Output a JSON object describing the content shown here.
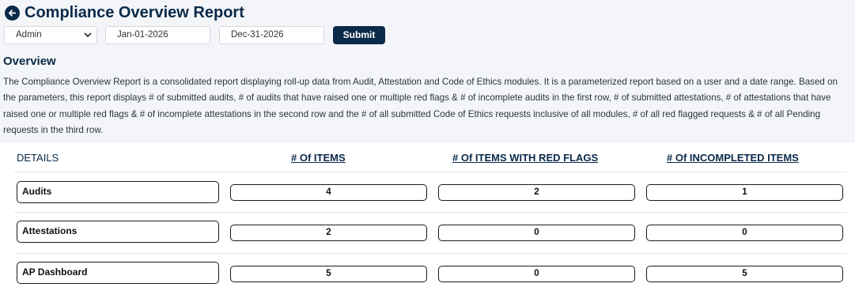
{
  "header": {
    "title": "Compliance Overview Report",
    "back_icon": "arrow-left-circle-icon"
  },
  "filters": {
    "user_value": "Admin",
    "start_date": "Jan-01-2026",
    "end_date": "Dec-31-2026",
    "submit_label": "Submit"
  },
  "overview": {
    "title": "Overview",
    "text": "The Compliance Overview Report is a consolidated report displaying roll-up data from Audit, Attestation and Code of Ethics modules. It is a parameterized report based on a user and a date range. Based on the parameters, this report displays # of submitted audits, # of audits that have raised one or multiple red flags & # of incomplete audits in the first row, # of submitted attestations, # of attestations that have raised one or multiple red flags & # of incomplete attestations in the second row and the # of all submitted Code of Ethics requests inclusive of all modules, # of all red flagged requests & # of all Pending requests in the third row."
  },
  "table": {
    "headers": {
      "details": "DETAILS",
      "items": "# Of ITEMS",
      "red_flags": "# Of ITEMS WITH RED FLAGS",
      "incompleted": "# Of INCOMPLETED ITEMS"
    },
    "rows": [
      {
        "label": "Audits",
        "items": "4",
        "red_flags": "2",
        "incompleted": "1"
      },
      {
        "label": "Attestations",
        "items": "2",
        "red_flags": "0",
        "incompleted": "0"
      },
      {
        "label": "AP Dashboard",
        "items": "5",
        "red_flags": "0",
        "incompleted": "5"
      }
    ]
  },
  "colors": {
    "primary": "#0b2a4a",
    "top_background": "#f3f5f8"
  }
}
